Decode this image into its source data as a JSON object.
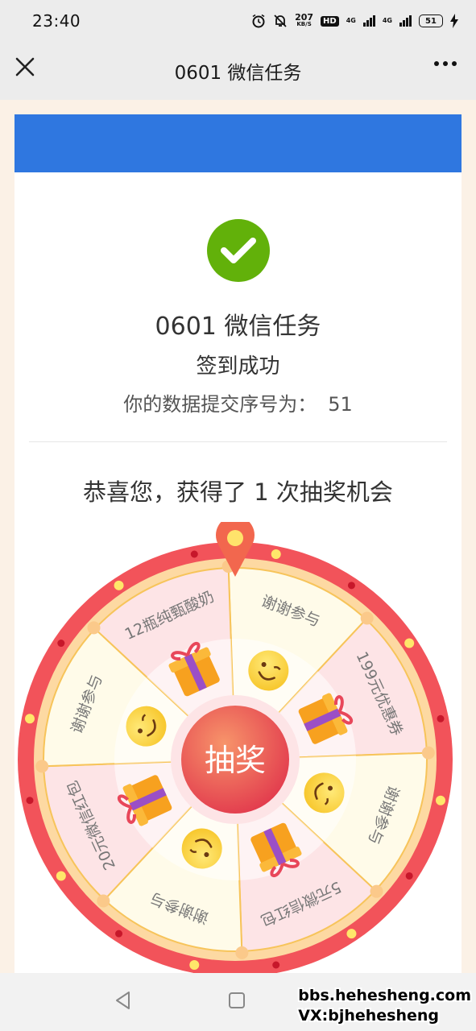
{
  "status_bar": {
    "time": "23:40",
    "speed": "207",
    "speed_unit": "KB/S",
    "hd": "HD",
    "net1": "4G",
    "net2": "4G",
    "battery": "51",
    "icons": [
      "alarm-icon",
      "mute-icon",
      "signal-icon",
      "signal-icon",
      "battery-icon",
      "charging-icon"
    ]
  },
  "header": {
    "title": "0601 微信任务",
    "close_icon": "close-icon",
    "more_icon": "more-icon"
  },
  "result": {
    "task_title": "0601 微信任务",
    "status": "签到成功",
    "serial_label": "你的数据提交序号为：",
    "serial_value": "51",
    "congrats": "恭喜您，获得了 1 次抽奖机会"
  },
  "wheel": {
    "center_label": "抽奖",
    "prizes": [
      {
        "label": "谢谢参与",
        "icon": "smile-icon"
      },
      {
        "label": "199元优惠券",
        "icon": "gift-icon"
      },
      {
        "label": "谢谢参与",
        "icon": "smile-icon"
      },
      {
        "label": "5元微信红包",
        "icon": "gift-icon"
      },
      {
        "label": "谢谢参与",
        "icon": "smile-icon"
      },
      {
        "label": "20元微信红包",
        "icon": "gift-icon"
      },
      {
        "label": "谢谢参与",
        "icon": "smile-icon"
      },
      {
        "label": "12瓶纯甄酸奶",
        "icon": "gift-icon"
      }
    ],
    "colors": {
      "rim": "#f2535a",
      "inner_ring": "#fdd9a2",
      "slice_pink": "#fde4e6",
      "slice_cream": "#fffbe9",
      "divider": "#f7c45a",
      "button": "#e94d54"
    }
  },
  "watermark": {
    "line1": "bbs.hehesheng.com",
    "line2": "VX:bjhehesheng"
  },
  "colors": {
    "banner": "#2f77e0",
    "success": "#62b10a"
  }
}
